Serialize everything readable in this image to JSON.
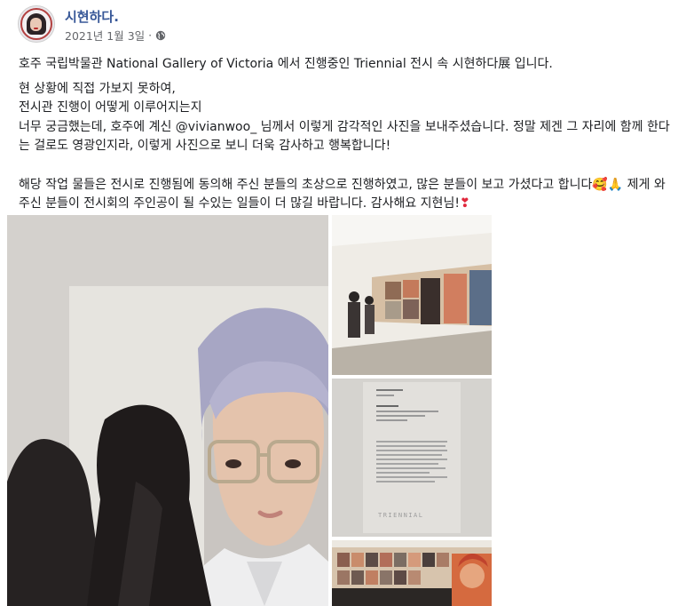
{
  "post": {
    "author": "시현하다.",
    "date": "2021년 1월 3일",
    "separator": "·",
    "privacy_icon": "globe-icon",
    "paragraphs": [
      "호주 국립박물관 National Gallery of Victoria 에서 진행중인 Triennial 전시 속 시현하다展 입니다.",
      "현 상황에 직접 가보지 못하여,",
      "전시관 진행이 어떻게 이루어지는지",
      "너무 궁금했는데, 호주에 계신 @vivianwoo_ 님께서 이렇게 감각적인 사진을 보내주셨습니다. 정말 제겐 그 자리에 함께 한다는 걸로도 영광인지라, 이렇게 사진으로 보니 더욱 감사하고 행복합니다!",
      "해당 작업 물들은 전시로 진행됨에 동의해 주신 분들의 초상으로 진행하였고, 많은 분들이 보고 가셨다고 합니다🥰🙏 제게 와주신 분들이 전시회의 주인공이 될 수있는 일들이 더 많길 바랍니다. 감사해요 지현님!",
      "❣"
    ]
  },
  "photos": {
    "label_name": "Kim Sihyun",
    "label_title": "Untitled",
    "label_brand": "TRIENNIAL"
  },
  "colors": {
    "author": "#385898",
    "meta": "#65676b",
    "text": "#1c1e21",
    "hair": "#a7a6c4"
  }
}
